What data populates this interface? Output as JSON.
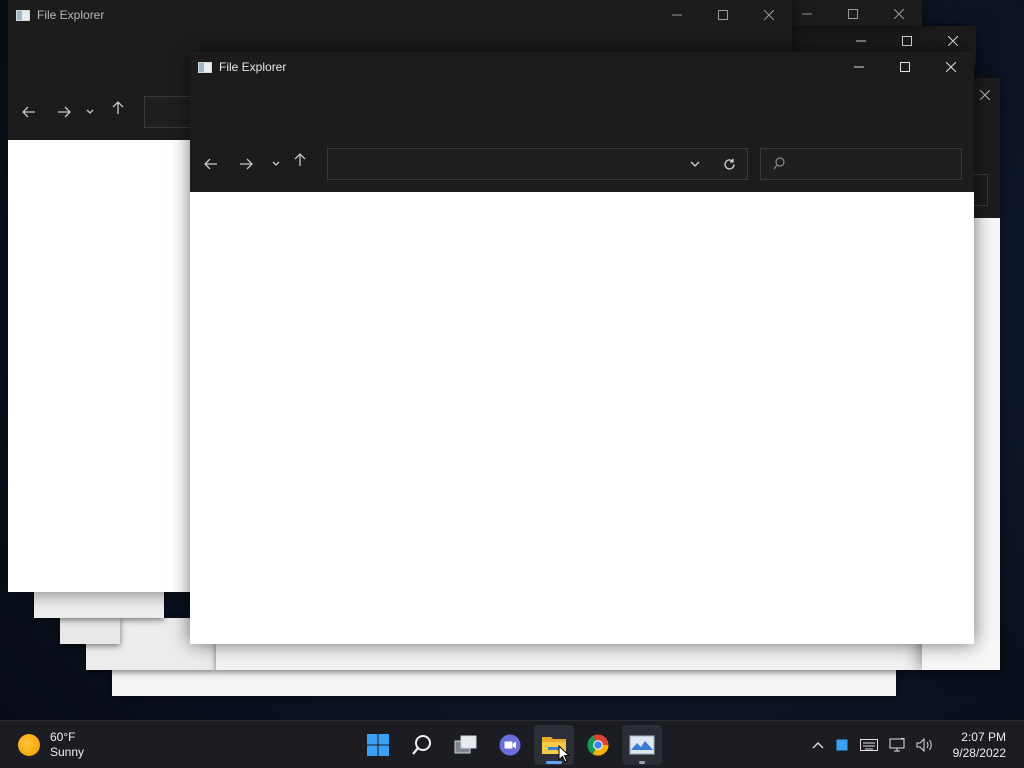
{
  "windows": {
    "title": "File Explorer",
    "address_value": "",
    "search_placeholder": ""
  },
  "taskbar": {
    "weather": {
      "temp": "60°F",
      "condition": "Sunny"
    },
    "apps": [
      {
        "name": "start",
        "icon": "windows-logo-icon"
      },
      {
        "name": "search",
        "icon": "search-icon"
      },
      {
        "name": "task-view",
        "icon": "task-view-icon"
      },
      {
        "name": "chat",
        "icon": "chat-icon"
      },
      {
        "name": "file-explorer",
        "icon": "folder-icon",
        "state": "active"
      },
      {
        "name": "chrome",
        "icon": "chrome-icon"
      },
      {
        "name": "app",
        "icon": "image-viewer-icon",
        "state": "running"
      }
    ],
    "tray_icons": [
      "chevron-up-icon",
      "notification-icon",
      "keyboard-icon",
      "network-icon",
      "volume-icon"
    ],
    "clock": {
      "time": "2:07 PM",
      "date": "9/28/2022"
    }
  },
  "colors": {
    "titlebar": "#1c1c1c",
    "content": "#ffffff",
    "taskbar": "#1b1d22",
    "accent": "#60a5fa"
  }
}
